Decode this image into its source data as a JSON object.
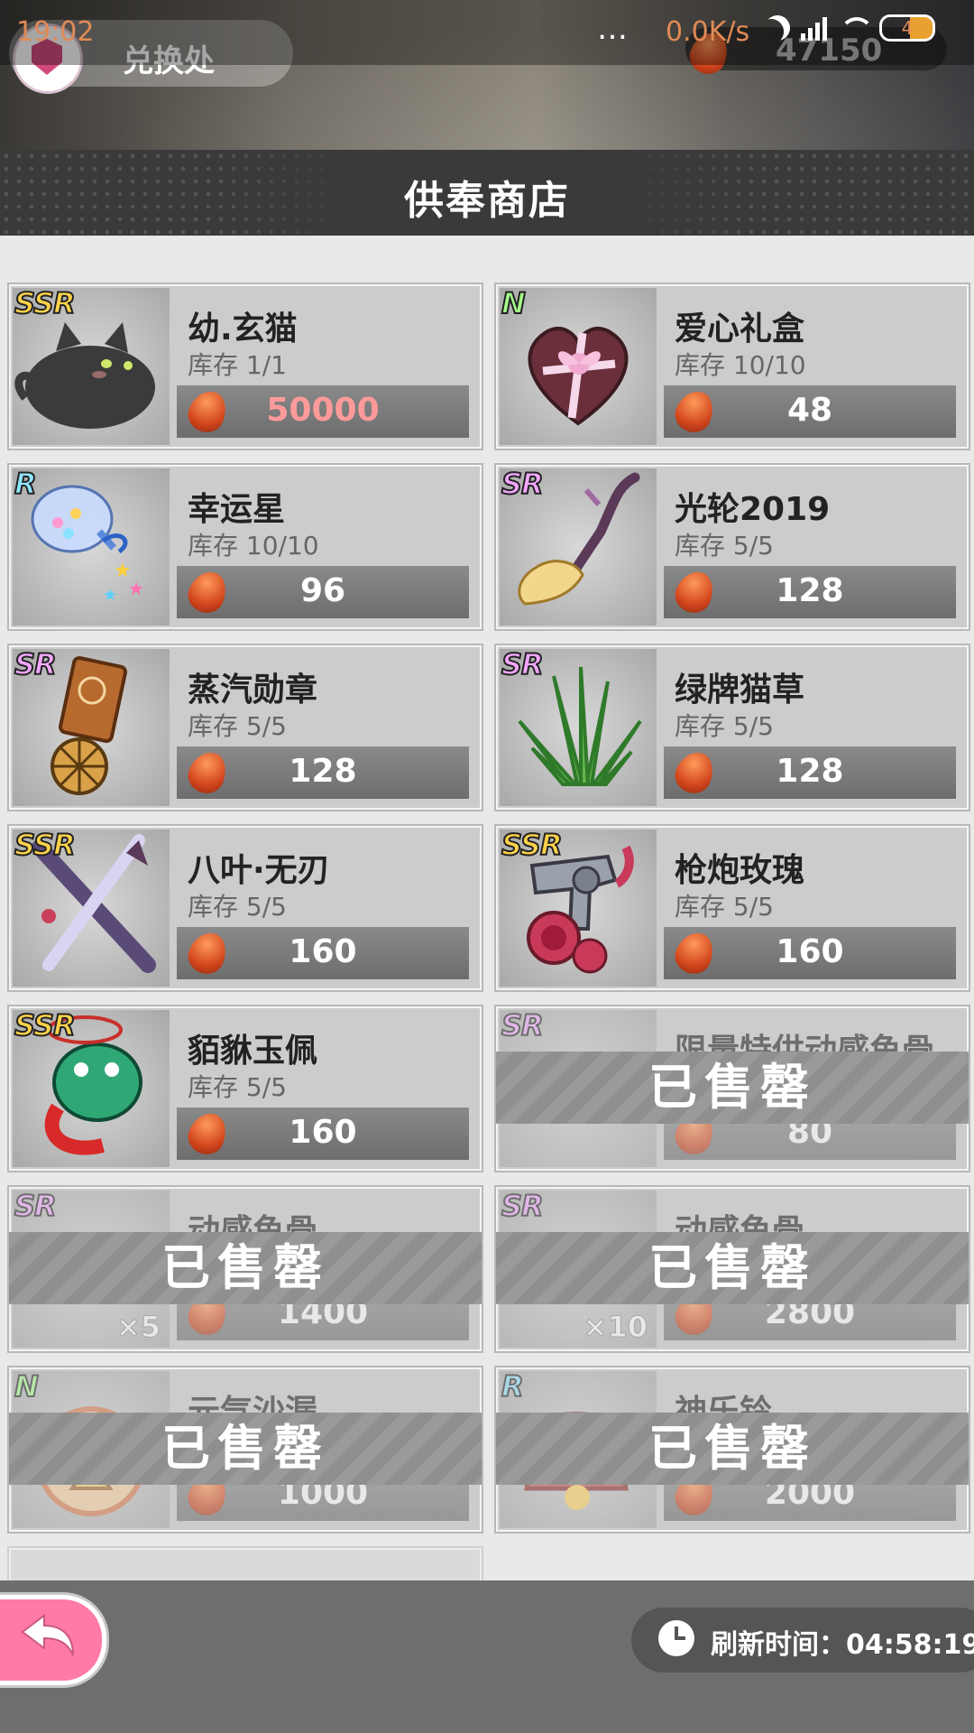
{
  "status_bar": {
    "time": "19:02",
    "menu_dots": "…",
    "net_speed": "0.0K/s",
    "battery": "4"
  },
  "top": {
    "exchange_label": "兑换处",
    "gold_amount": "47150"
  },
  "shop": {
    "title": "供奉商店",
    "items": [
      {
        "rarity": "SSR",
        "name": "幼.玄猫",
        "stock": "库存 1/1",
        "price": "50000",
        "art": "black-cat"
      },
      {
        "rarity": "N",
        "name": "爱心礼盒",
        "stock": "库存 10/10",
        "price": "48",
        "art": "heart-box"
      },
      {
        "rarity": "R",
        "name": "幸运星",
        "stock": "库存 10/10",
        "price": "96",
        "art": "star-bottle"
      },
      {
        "rarity": "SR",
        "name": "光轮2019",
        "stock": "库存 5/5",
        "price": "128",
        "art": "broom"
      },
      {
        "rarity": "SR",
        "name": "蒸汽勋章",
        "stock": "库存 5/5",
        "price": "128",
        "art": "medal"
      },
      {
        "rarity": "SR",
        "name": "绿牌猫草",
        "stock": "库存 5/5",
        "price": "128",
        "art": "grass"
      },
      {
        "rarity": "SSR",
        "name": "八叶·无刃",
        "stock": "库存 5/5",
        "price": "160",
        "art": "swords"
      },
      {
        "rarity": "SSR",
        "name": "枪炮玫瑰",
        "stock": "库存 5/5",
        "price": "160",
        "art": "gun-rose"
      },
      {
        "rarity": "SSR",
        "name": "貊貅玉佩",
        "stock": "库存 5/5",
        "price": "160",
        "art": "jade-beast"
      },
      {
        "rarity": "SR",
        "name": "限量特供动感鱼骨",
        "stock": "",
        "price": "80",
        "art": "fishbone",
        "sold_out": true
      },
      {
        "rarity": "SR",
        "name": "动感鱼骨",
        "stock": "",
        "price": "1400",
        "art": "fishbone",
        "qty": "×5",
        "sold_out": true
      },
      {
        "rarity": "SR",
        "name": "动感鱼骨",
        "stock": "",
        "price": "2800",
        "art": "fishbone",
        "qty": "×10",
        "sold_out": true
      },
      {
        "rarity": "N",
        "name": "元气沙漏",
        "stock": "",
        "price": "1000",
        "art": "hourglass",
        "sold_out": true
      },
      {
        "rarity": "R",
        "name": "神乐铃",
        "stock": "",
        "price": "2000",
        "art": "bell",
        "sold_out": true
      }
    ],
    "sold_out_label": "已售罄"
  },
  "bottom": {
    "refresh_label": "刷新时间：04:58:19"
  },
  "icons": [
    "back-arrow-icon",
    "clock-icon",
    "bean-currency-icon",
    "moon-icon",
    "signal-icon",
    "wifi-icon",
    "battery-icon"
  ]
}
